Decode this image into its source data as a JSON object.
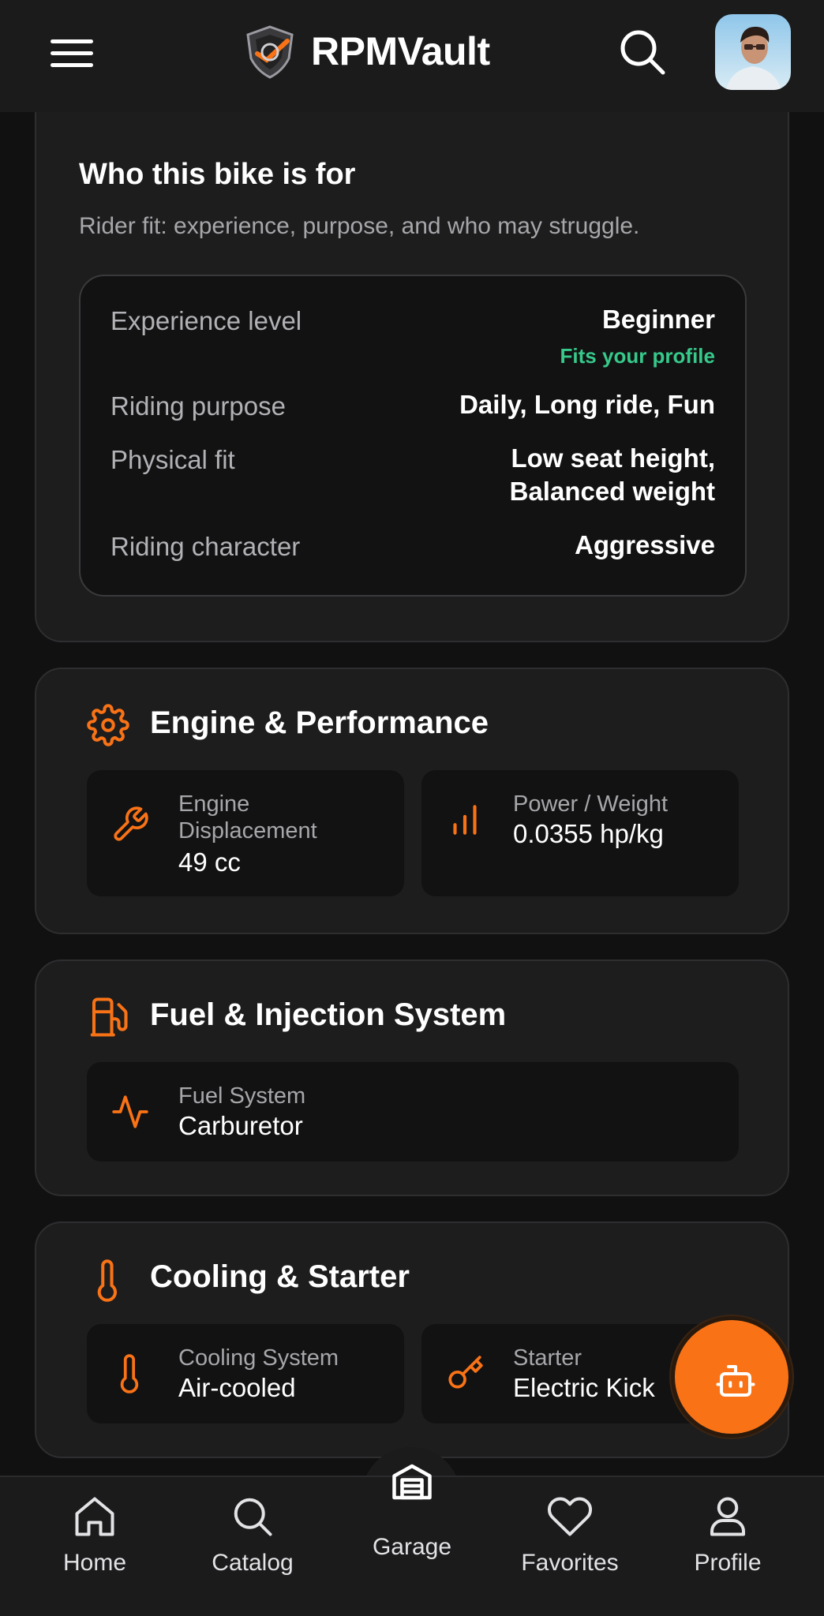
{
  "app": {
    "brand": "RPMVault"
  },
  "header": {
    "menu_icon": "hamburger-icon",
    "search_icon": "search-icon"
  },
  "fit": {
    "title": "Who this bike is for",
    "subtitle": "Rider fit: experience, purpose, and who may struggle.",
    "rows": [
      {
        "label": "Experience level",
        "value": "Beginner",
        "note": "Fits your profile"
      },
      {
        "label": "Riding purpose",
        "value": "Daily, Long ride, Fun"
      },
      {
        "label": "Physical fit",
        "value_line1": "Low seat height,",
        "value_line2": "Balanced weight"
      },
      {
        "label": "Riding character",
        "value": "Aggressive"
      }
    ]
  },
  "engine": {
    "title": "Engine & Performance",
    "tiles": [
      {
        "label_line1": "Engine",
        "label_line2": "Displacement",
        "value": "49 cc",
        "icon": "wrench-icon"
      },
      {
        "label": "Power / Weight",
        "value": "0.0355 hp/kg",
        "icon": "bar-chart-icon"
      }
    ]
  },
  "fuel": {
    "title": "Fuel & Injection System",
    "tiles": [
      {
        "label": "Fuel System",
        "value": "Carburetor",
        "icon": "activity-icon"
      }
    ]
  },
  "cooling": {
    "title": "Cooling & Starter",
    "tiles": [
      {
        "label": "Cooling System",
        "value": "Air-cooled",
        "icon": "thermometer-icon"
      },
      {
        "label": "Starter",
        "value": "Electric Kick",
        "icon": "key-icon"
      }
    ]
  },
  "nav": [
    {
      "label": "Home",
      "icon": "home-icon"
    },
    {
      "label": "Catalog",
      "icon": "search-icon"
    },
    {
      "label": "Garage",
      "icon": "garage-icon"
    },
    {
      "label": "Favorites",
      "icon": "heart-icon"
    },
    {
      "label": "Profile",
      "icon": "user-icon"
    }
  ],
  "colors": {
    "accent": "#f97316",
    "success": "#36c98a",
    "background": "#111112",
    "card": "#1d1d1e"
  }
}
